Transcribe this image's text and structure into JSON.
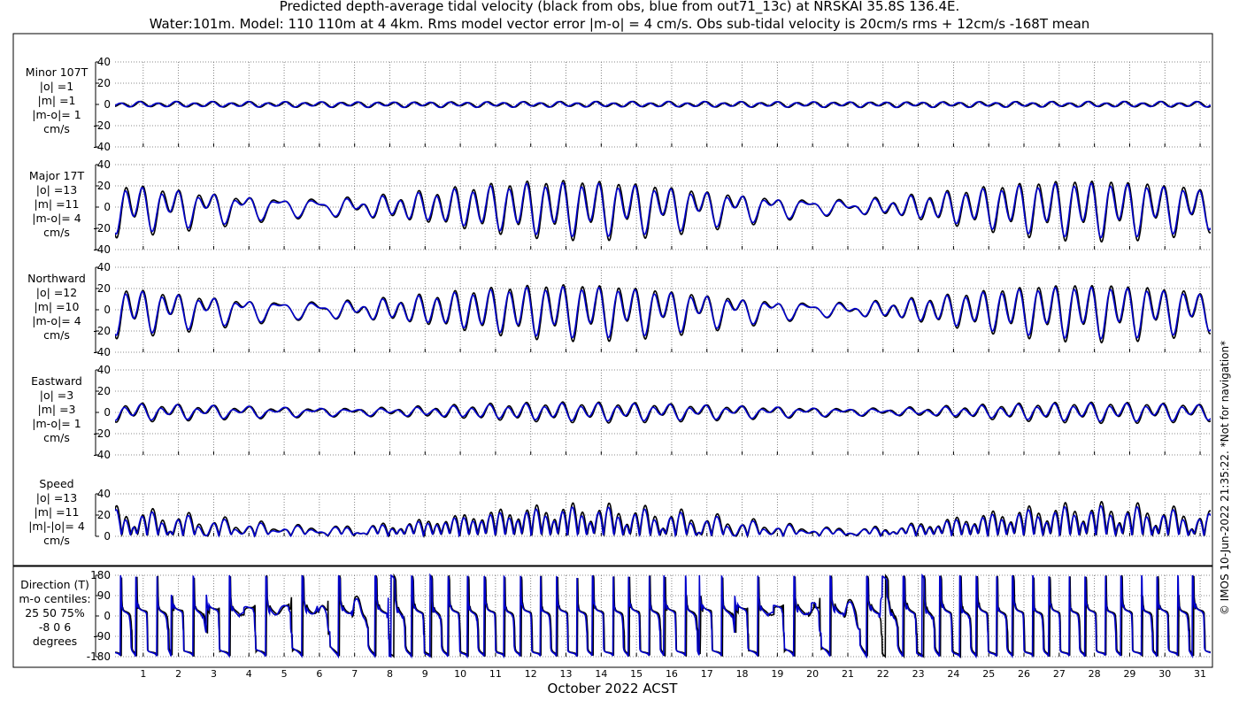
{
  "title": {
    "line1": "Predicted depth-average tidal velocity (black from obs, blue from out71_13c) at NRSKAI 35.8S 136.4E.",
    "line2": "Water:101m. Model: 110 110m at 4 4km. Rms model vector error |m-o| = 4 cm/s. Obs sub-tidal velocity is 20cm/s rms + 12cm/s -168T mean"
  },
  "xlabel": "October 2022 ACST",
  "credit": "© IMOS 10-Jun-2022 21:35:22. *Not for navigation*",
  "colors": {
    "obs": "#000000",
    "model": "#0000cc",
    "grid": "#666666"
  },
  "chart_data": [
    {
      "id": "minor",
      "type": "line",
      "label_lines": [
        "Minor 107T",
        "|o| =1",
        "|m| =1",
        "|m-o|= 1",
        "cm/s"
      ],
      "ylim": [
        -40,
        40
      ],
      "yticks": [
        -40,
        -20,
        0,
        20,
        40
      ],
      "ytick_labels": [
        "-40",
        "-20",
        "0",
        "20",
        "40"
      ],
      "xlim": [
        0.2,
        31.3
      ],
      "x_ticks": [
        1,
        2,
        3,
        4,
        5,
        6,
        7,
        8,
        9,
        10,
        11,
        12,
        13,
        14,
        15,
        16,
        17,
        18,
        19,
        20,
        21,
        22,
        23,
        24,
        25,
        26,
        27,
        28,
        29,
        30,
        31
      ],
      "series": [
        {
          "role": "obs",
          "quantity": "minor",
          "amplitude": 1,
          "unit": "cm/s"
        },
        {
          "role": "model",
          "quantity": "minor",
          "amplitude": 1,
          "unit": "cm/s"
        }
      ]
    },
    {
      "id": "major",
      "type": "line",
      "label_lines": [
        "Major 17T",
        "|o| =13",
        "|m| =11",
        "|m-o|= 4",
        "cm/s"
      ],
      "ylim": [
        -40,
        40
      ],
      "yticks": [
        -40,
        -20,
        0,
        20,
        40
      ],
      "ytick_labels": [
        "-40",
        "-20",
        "0",
        "20",
        "40"
      ],
      "xlim": [
        0.2,
        31.3
      ],
      "x_ticks": [
        1,
        2,
        3,
        4,
        5,
        6,
        7,
        8,
        9,
        10,
        11,
        12,
        13,
        14,
        15,
        16,
        17,
        18,
        19,
        20,
        21,
        22,
        23,
        24,
        25,
        26,
        27,
        28,
        29,
        30,
        31
      ],
      "series": [
        {
          "role": "obs",
          "quantity": "major",
          "amplitude": 13,
          "unit": "cm/s"
        },
        {
          "role": "model",
          "quantity": "major",
          "amplitude": 11,
          "unit": "cm/s"
        }
      ]
    },
    {
      "id": "north",
      "type": "line",
      "label_lines": [
        "Northward",
        "|o| =12",
        "|m| =10",
        "|m-o|= 4",
        "cm/s"
      ],
      "ylim": [
        -40,
        40
      ],
      "yticks": [
        -40,
        -20,
        0,
        20,
        40
      ],
      "ytick_labels": [
        "-40",
        "-20",
        "0",
        "20",
        "40"
      ],
      "xlim": [
        0.2,
        31.3
      ],
      "x_ticks": [
        1,
        2,
        3,
        4,
        5,
        6,
        7,
        8,
        9,
        10,
        11,
        12,
        13,
        14,
        15,
        16,
        17,
        18,
        19,
        20,
        21,
        22,
        23,
        24,
        25,
        26,
        27,
        28,
        29,
        30,
        31
      ],
      "series": [
        {
          "role": "obs",
          "quantity": "north",
          "amplitude": 12,
          "unit": "cm/s"
        },
        {
          "role": "model",
          "quantity": "north",
          "amplitude": 10,
          "unit": "cm/s"
        }
      ]
    },
    {
      "id": "east",
      "type": "line",
      "label_lines": [
        "Eastward",
        "|o| =3",
        "|m| =3",
        "|m-o|= 1",
        "cm/s"
      ],
      "ylim": [
        -40,
        40
      ],
      "yticks": [
        -40,
        -20,
        0,
        20,
        40
      ],
      "ytick_labels": [
        "-40",
        "-20",
        "0",
        "20",
        "40"
      ],
      "xlim": [
        0.2,
        31.3
      ],
      "x_ticks": [
        1,
        2,
        3,
        4,
        5,
        6,
        7,
        8,
        9,
        10,
        11,
        12,
        13,
        14,
        15,
        16,
        17,
        18,
        19,
        20,
        21,
        22,
        23,
        24,
        25,
        26,
        27,
        28,
        29,
        30,
        31
      ],
      "series": [
        {
          "role": "obs",
          "quantity": "east",
          "amplitude": 3,
          "unit": "cm/s"
        },
        {
          "role": "model",
          "quantity": "east",
          "amplitude": 3,
          "unit": "cm/s"
        }
      ]
    },
    {
      "id": "speed",
      "type": "line",
      "label_lines": [
        "Speed",
        "|o| =13",
        "|m| =11",
        "|m|-|o|= 4",
        "cm/s"
      ],
      "ylim": [
        0,
        40
      ],
      "yticks": [
        0,
        20,
        40
      ],
      "ytick_labels": [
        "0",
        "20",
        "40"
      ],
      "xlim": [
        0.2,
        31.3
      ],
      "x_ticks": [
        1,
        2,
        3,
        4,
        5,
        6,
        7,
        8,
        9,
        10,
        11,
        12,
        13,
        14,
        15,
        16,
        17,
        18,
        19,
        20,
        21,
        22,
        23,
        24,
        25,
        26,
        27,
        28,
        29,
        30,
        31
      ],
      "series": [
        {
          "role": "obs",
          "quantity": "speed",
          "amplitude": 13,
          "unit": "cm/s"
        },
        {
          "role": "model",
          "quantity": "speed",
          "amplitude": 11,
          "unit": "cm/s"
        }
      ]
    },
    {
      "id": "direction",
      "type": "line",
      "label_lines": [
        "Direction (T)",
        "m-o centiles:",
        "25  50  75%",
        "-8   0   6",
        "degrees"
      ],
      "ylim": [
        -180,
        180
      ],
      "yticks": [
        -180,
        -90,
        0,
        90,
        180
      ],
      "ytick_labels": [
        "-180",
        "-90",
        "0",
        "90",
        "180"
      ],
      "xlim": [
        0.2,
        31.3
      ],
      "x_ticks": [
        1,
        2,
        3,
        4,
        5,
        6,
        7,
        8,
        9,
        10,
        11,
        12,
        13,
        14,
        15,
        16,
        17,
        18,
        19,
        20,
        21,
        22,
        23,
        24,
        25,
        26,
        27,
        28,
        29,
        30,
        31
      ],
      "x_tick_labels": [
        "1",
        "2",
        "3",
        "4",
        "5",
        "6",
        "7",
        "8",
        "9",
        "10",
        "11",
        "12",
        "13",
        "14",
        "15",
        "16",
        "17",
        "18",
        "19",
        "20",
        "21",
        "22",
        "23",
        "24",
        "25",
        "26",
        "27",
        "28",
        "29",
        "30",
        "31"
      ],
      "centiles": {
        "p25": -8,
        "p50": 0,
        "p75": 6
      },
      "series": [
        {
          "role": "obs",
          "quantity": "direction",
          "unit": "degrees"
        },
        {
          "role": "model",
          "quantity": "direction",
          "unit": "degrees"
        }
      ]
    }
  ]
}
